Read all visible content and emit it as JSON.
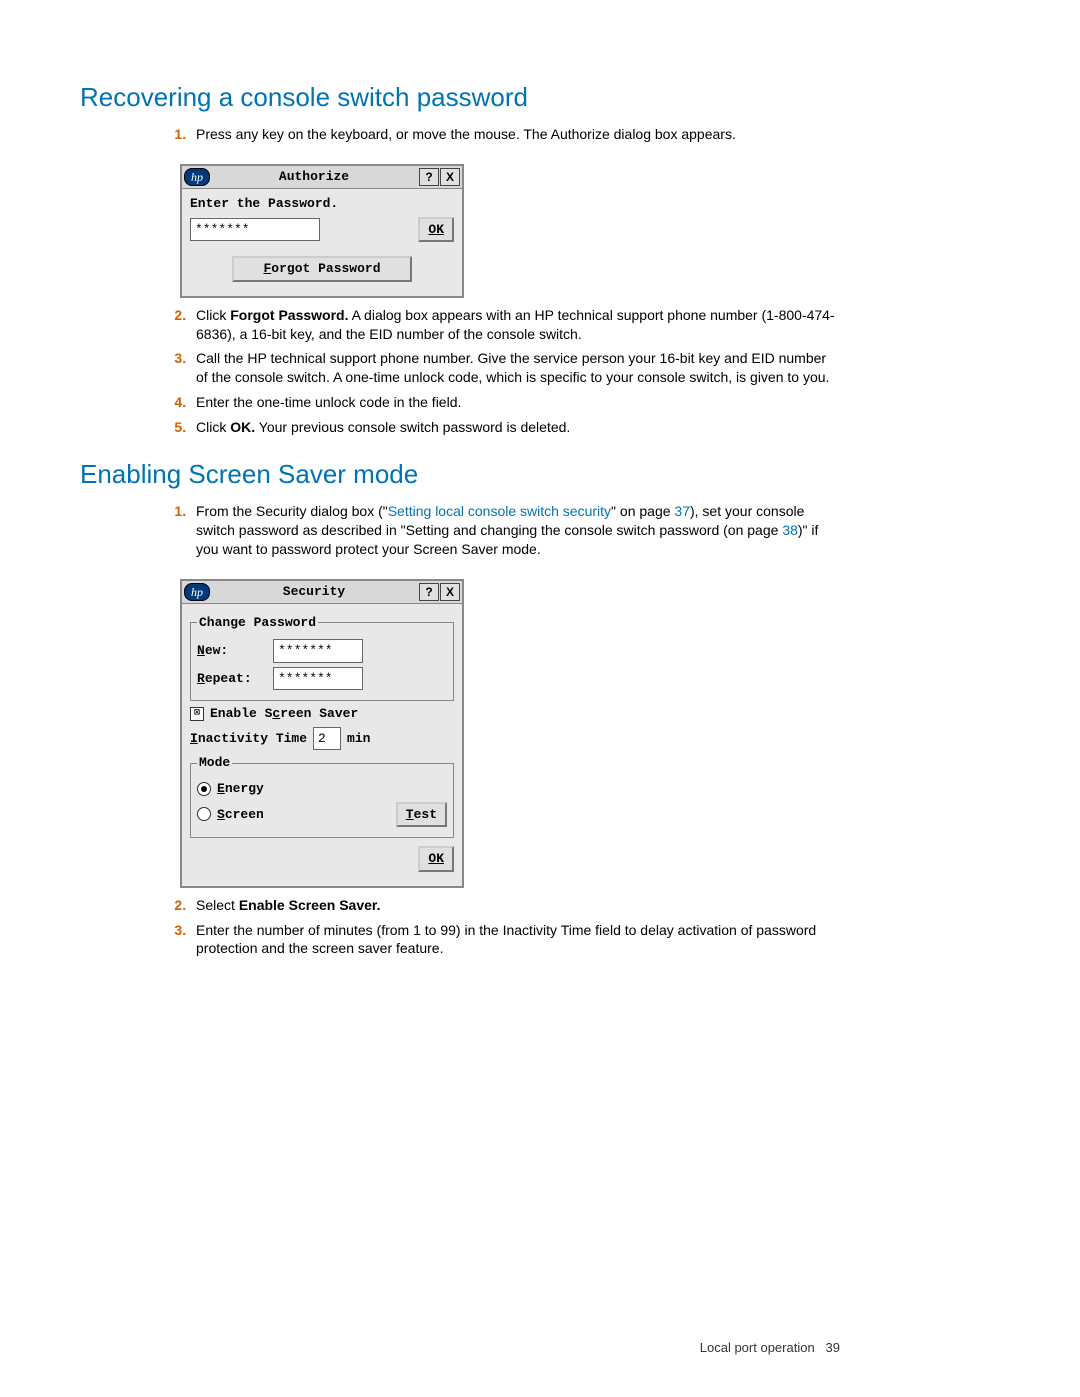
{
  "section1": {
    "heading": "Recovering a console switch password",
    "step1": "Press any key on the keyboard, or move the mouse. The Authorize dialog box appears.",
    "step2a": "Click ",
    "step2b": "Forgot Password.",
    "step2c": " A dialog box appears with an HP technical support phone number (1-800-474-6836), a 16-bit key, and the EID number of the console switch.",
    "step3": "Call the HP technical support phone number. Give the service person your 16-bit key and EID number of the console switch. A one-time unlock code, which is specific to your console switch, is given to you.",
    "step4": "Enter the one-time unlock code in the field.",
    "step5a": "Click ",
    "step5b": "OK.",
    "step5c": " Your previous console switch password is deleted."
  },
  "authorize_dialog": {
    "logo": "hp",
    "title": "Authorize",
    "help": "?",
    "close": "X",
    "prompt": "Enter the Password.",
    "password_value": "*******",
    "ok": "OK",
    "forgot": "Forgot Password"
  },
  "section2": {
    "heading": "Enabling Screen Saver mode",
    "step1a": "From the Security dialog box (\"",
    "step1link": "Setting local console switch security",
    "step1b": "\" on page ",
    "step1page": "37",
    "step1c": "), set your console switch password as described in \"Setting and changing the console switch password (on page ",
    "step1page2": "38",
    "step1d": ")\" if you want to password protect your Screen Saver mode.",
    "step2a": "Select ",
    "step2b": "Enable Screen Saver.",
    "step3": "Enter the number of minutes (from 1 to 99) in the Inactivity Time field to delay activation of password protection and the screen saver feature."
  },
  "security_dialog": {
    "logo": "hp",
    "title": "Security",
    "help": "?",
    "close": "X",
    "change_pw_label": "Change Password",
    "new_label": "New:",
    "new_value": "*******",
    "repeat_label": "Repeat:",
    "repeat_value": "*******",
    "enable_label_pre": "Enable S",
    "enable_label_c": "c",
    "enable_label_post": "reen Saver",
    "enable_checked": "⊠",
    "inactivity_label": "Inactivity Time",
    "inactivity_value": "2",
    "min_label": "min",
    "mode_label": "Mode",
    "energy_label": "Energy",
    "screen_label": "Screen",
    "test_btn": "Test",
    "ok_btn": "OK"
  },
  "footer": {
    "text": "Local port operation",
    "page": "39"
  }
}
